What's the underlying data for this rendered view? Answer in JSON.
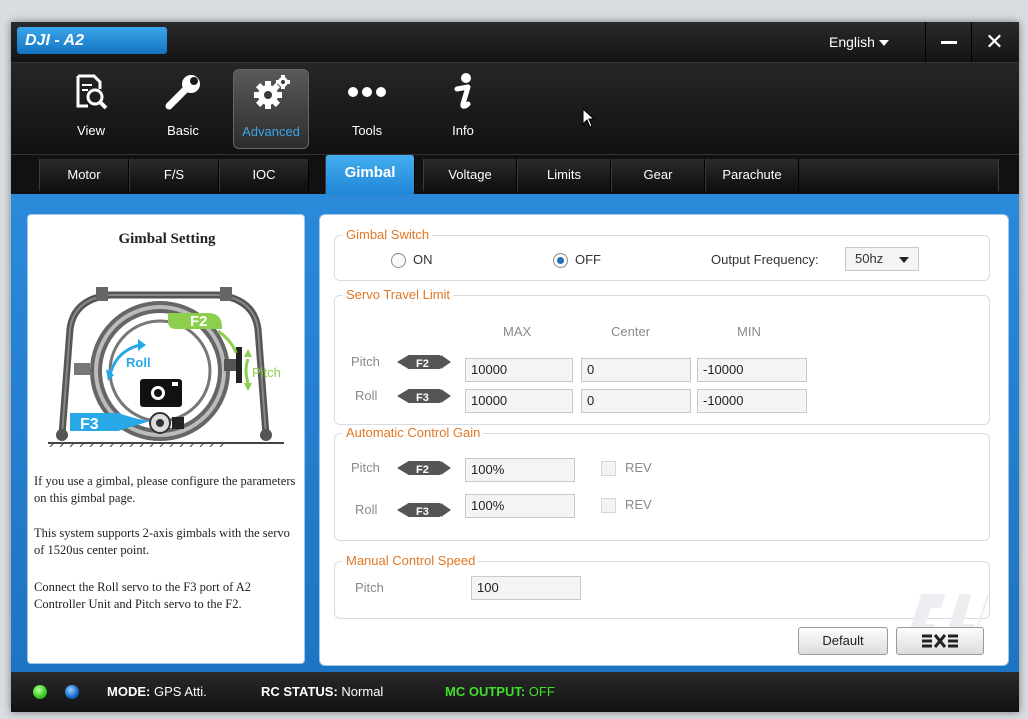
{
  "app": {
    "title": "DJI - A2",
    "language": "English"
  },
  "window": {
    "minimize": "—",
    "close": "✕"
  },
  "toolbar": [
    {
      "label": "View",
      "icon": "magnifier-doc-icon"
    },
    {
      "label": "Basic",
      "icon": "wrench-icon"
    },
    {
      "label": "Advanced",
      "icon": "gears-icon",
      "active": true
    },
    {
      "label": "Tools",
      "icon": "dots-icon"
    },
    {
      "label": "Info",
      "icon": "info-icon"
    }
  ],
  "tabs": [
    "Motor",
    "F/S",
    "IOC",
    "Gimbal",
    "Voltage",
    "Limits",
    "Gear",
    "Parachute"
  ],
  "active_tab": "Gimbal",
  "left_panel": {
    "title": "Gimbal Setting",
    "diagram_labels": {
      "f2": "F2",
      "f3": "F3",
      "roll": "Roll",
      "pitch": "Pitch"
    },
    "paragraphs": [
      "If you use a gimbal, please configure the parameters on this gimbal page.",
      "This system supports 2-axis gimbals with the servo of 1520us center point.",
      "Connect the Roll servo to the F3 port of A2 Controller Unit and Pitch servo to the F2."
    ]
  },
  "gimbal_switch": {
    "title": "Gimbal Switch",
    "on_label": "ON",
    "off_label": "OFF",
    "selected": "OFF",
    "output_frequency_label": "Output Frequency:",
    "output_frequency_value": "50hz"
  },
  "servo_travel_limit": {
    "title": "Servo Travel Limit",
    "columns": [
      "MAX",
      "Center",
      "MIN"
    ],
    "rows": [
      {
        "label": "Pitch",
        "port": "F2",
        "max": "10000",
        "center": "0",
        "min": "-10000"
      },
      {
        "label": "Roll",
        "port": "F3",
        "max": "10000",
        "center": "0",
        "min": "-10000"
      }
    ]
  },
  "automatic_control_gain": {
    "title": "Automatic Control Gain",
    "rows": [
      {
        "label": "Pitch",
        "port": "F2",
        "value": "100%",
        "rev": "REV"
      },
      {
        "label": "Roll",
        "port": "F3",
        "value": "100%",
        "rev": "REV"
      }
    ]
  },
  "manual_control_speed": {
    "title": "Manual Control Speed",
    "rows": [
      {
        "label": "Pitch",
        "value": "100"
      }
    ]
  },
  "buttons": {
    "default": "Default"
  },
  "status": {
    "mode_label": "MODE:",
    "mode_value": "GPS Atti.",
    "rc_label": "RC STATUS:",
    "rc_value": "Normal",
    "mc_label": "MC OUTPUT:",
    "mc_value": "OFF",
    "colors": {
      "led_green": "#3fcf2a",
      "led_blue": "#1b6fd0",
      "mc": "#3fdf2a"
    }
  }
}
